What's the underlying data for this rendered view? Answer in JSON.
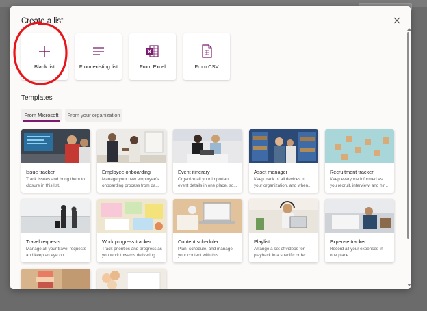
{
  "dialog": {
    "title": "Create a list"
  },
  "create_options": [
    {
      "label": "Blank list",
      "icon": "plus-icon"
    },
    {
      "label": "From existing list",
      "icon": "list-lines-icon"
    },
    {
      "label": "From Excel",
      "icon": "excel-icon"
    },
    {
      "label": "From CSV",
      "icon": "csv-file-icon"
    }
  ],
  "templates": {
    "heading": "Templates",
    "tabs": [
      "From Microsoft",
      "From your organization"
    ],
    "cards": [
      {
        "title": "Issue tracker",
        "desc": "Track issues and bring them to closure in this list."
      },
      {
        "title": "Employee onboarding",
        "desc": "Manage your new employee's onboarding process from da..."
      },
      {
        "title": "Event itinerary",
        "desc": "Organize all your important event details in one place, so..."
      },
      {
        "title": "Asset manager",
        "desc": "Keep track of all devices in your organization, and when..."
      },
      {
        "title": "Recruitment tracker",
        "desc": "Keep everyone informed as you recruit, interview, and hir..."
      },
      {
        "title": "Travel requests",
        "desc": "Manage all your travel requests and keep an eye on..."
      },
      {
        "title": "Work progress tracker",
        "desc": "Track priorities and progress as you work towards delivering..."
      },
      {
        "title": "Content scheduler",
        "desc": "Plan, schedule, and manage your content with this..."
      },
      {
        "title": "Playlist",
        "desc": "Arrange a set of videos for playback in a specific order."
      },
      {
        "title": "Expense tracker",
        "desc": "Record all your expenses in one place."
      }
    ]
  },
  "colors": {
    "accent": "#7a1b6f",
    "annotation": "#e8141c",
    "excel_green": "#217346"
  }
}
